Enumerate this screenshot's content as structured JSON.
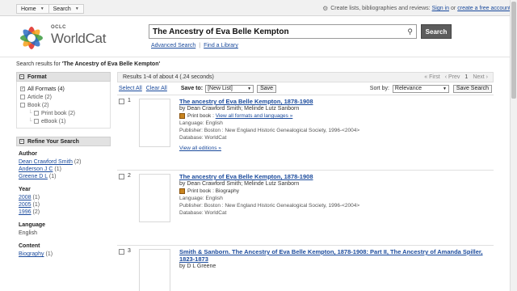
{
  "topbar": {
    "nav": [
      {
        "label": "Home"
      },
      {
        "label": "Search"
      }
    ],
    "prompt": "Create lists, bibliographies and reviews:",
    "signin": "Sign in",
    "or": "or",
    "create": "create a free account"
  },
  "logo": {
    "small": "OCLC",
    "name": "WorldCat"
  },
  "search": {
    "query": "The Ancestry of Eva Belle Kempton",
    "button": "Search",
    "advanced": "Advanced Search",
    "library": "Find a Library"
  },
  "results_for": {
    "prefix": "Search results for",
    "query": "'The Ancestry of Eva Belle Kempton'"
  },
  "format": {
    "title": "Format",
    "items": [
      {
        "label": "All Formats (4)",
        "checked": true
      },
      {
        "label": "Article (2)"
      },
      {
        "label": "Book (2)"
      },
      {
        "label": "Print book (2)"
      },
      {
        "label": "eBook (1)"
      }
    ]
  },
  "refine": {
    "title": "Refine Your Search",
    "author": {
      "title": "Author",
      "items": [
        {
          "label": "Dean Crawford Smith",
          "count": "(2)"
        },
        {
          "label": "Anderson J C",
          "count": "(1)"
        },
        {
          "label": "Greene D L",
          "count": "(1)"
        }
      ]
    },
    "year": {
      "title": "Year",
      "items": [
        {
          "label": "2008",
          "count": "(1)"
        },
        {
          "label": "2005",
          "count": "(1)"
        },
        {
          "label": "1996",
          "count": "(2)"
        }
      ]
    },
    "language": {
      "title": "Language",
      "value": "English"
    },
    "content": {
      "title": "Content",
      "items": [
        {
          "label": "Biography",
          "count": "(1)"
        }
      ]
    }
  },
  "results": {
    "summary": "Results 1-4 of about 4 (.24 seconds)",
    "pager": {
      "first": "« First",
      "prev": "‹ Prev",
      "page": "1",
      "next": "Next ›"
    },
    "select_all": "Select All",
    "clear_all": "Clear All",
    "save_to": "Save to:",
    "list_value": "[New List]",
    "save": "Save",
    "sort_by": "Sort by:",
    "sort_value": "Relevance",
    "save_search": "Save Search"
  },
  "records": [
    {
      "num": "1",
      "title": "The ancestry of Eva Belle Kempton, 1878-1908",
      "author": "by Dean Crawford Smith; Melinde Lutz Sanborn",
      "format_label": "Print book",
      "formats_link": "View all formats and languages »",
      "language": "Language: English",
      "publisher": "Publisher: Boston : New England Historic Genealogical Society, 1996-<2004>",
      "database": "Database: WorldCat",
      "editions": "View all editions »"
    },
    {
      "num": "2",
      "title": "The ancestry of Eva Belle Kempton, 1878-1908",
      "author": "by Dean Crawford Smith; Melinde Lutz Sanborn",
      "format_label": "Print book : Biography",
      "language": "Language: English",
      "publisher": "Publisher: Boston : New England Historic Genealogical Society, 1996-<2004>",
      "database": "Database: WorldCat"
    },
    {
      "num": "3",
      "title": "Smith & Sanborn. The Ancestry of Eva Belle Kempton, 1878-1908: Part II, The Ancestry of Amanda Spiller, 1823-1873",
      "author": "by D L Greene"
    }
  ]
}
